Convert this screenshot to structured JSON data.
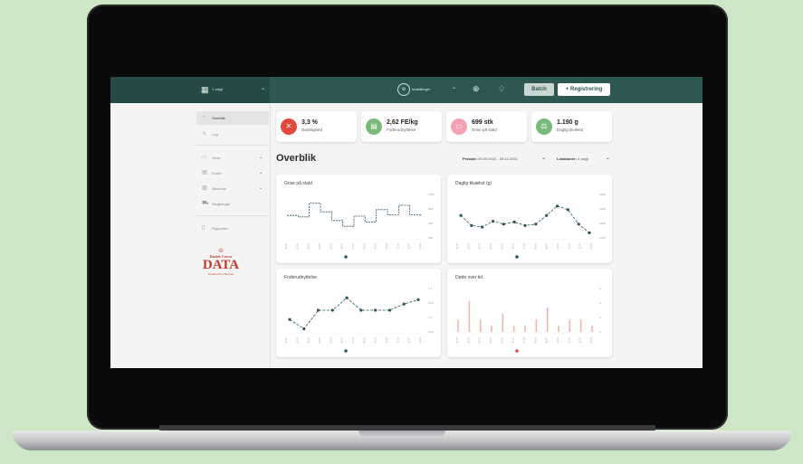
{
  "header": {
    "location_select": "1 valgt",
    "settings_label": "Indstillinger",
    "batch_label": "Batch",
    "register_label": "+ Registrering",
    "icons": [
      "building-icon",
      "settings-icon",
      "globe-icon",
      "bell-icon"
    ]
  },
  "sidebar": {
    "items": [
      {
        "label": "Overblik",
        "icon": "dashboard-icon",
        "active": true
      },
      {
        "label": "Log",
        "icon": "activity-icon"
      },
      {
        "label": "Grise",
        "icon": "pig-icon",
        "expandable": true
      },
      {
        "label": "Foder",
        "icon": "feed-icon",
        "expandable": true
      },
      {
        "label": "Økonomi",
        "icon": "economy-icon",
        "expandable": true
      },
      {
        "label": "Slagtninger",
        "icon": "truck-icon"
      },
      {
        "label": "Rapporter",
        "icon": "report-icon"
      }
    ],
    "logo": {
      "crown": "♔",
      "brand": "Danish Crown",
      "word": "DATA",
      "powered": "Powered by iTerobas"
    }
  },
  "kpis": [
    {
      "value": "3,3 %",
      "label": "Dødelighed",
      "icon": "x-icon",
      "color": "#e0493b"
    },
    {
      "value": "2,62 FE/kg",
      "label": "Foderudnyttelse",
      "icon": "feed-icon",
      "color": "#79b97a"
    },
    {
      "value": "699 stk",
      "label": "Grise på stald",
      "icon": "pig-icon",
      "color": "#f2a2b3"
    },
    {
      "value": "1.190 g",
      "label": "Daglig tilvækst",
      "icon": "scale-icon",
      "color": "#79b97a"
    }
  ],
  "main": {
    "title": "Overblik",
    "period_label": "Periode:",
    "period_value": "09.09.2021 - 09.12.2021",
    "location_label": "Lokationer:",
    "location_value": "1 valgt"
  },
  "colors": {
    "brand": "#2f5752",
    "line": "#2f5752",
    "bar": "#f3b6ad",
    "dot_red": "#e0493b"
  },
  "chart_data": [
    {
      "type": "line",
      "title": "Grise på stald",
      "style": "step-dashed",
      "x": [
        "01.01",
        "02.01",
        "03.01",
        "04.01",
        "05.01",
        "06.01",
        "07.01",
        "08.01",
        "09.01",
        "10.01",
        "11.01",
        "12.01",
        "13.01"
      ],
      "yticks": [
        "400",
        "600",
        "800",
        "1000"
      ],
      "ylim": [
        400,
        1000
      ],
      "values": [
        710,
        690,
        880,
        760,
        640,
        560,
        700,
        620,
        790,
        720,
        850,
        720,
        700
      ],
      "pager_dots": 1
    },
    {
      "type": "line",
      "title": "Daglig tilvækst (g)",
      "x": [
        "01.01",
        "02.01",
        "03.01",
        "04.01",
        "05.01",
        "06.01",
        "07.01",
        "08.01",
        "09.01",
        "10.01",
        "11.01",
        "12.01",
        "13.01"
      ],
      "yticks": [
        "1100",
        "1200",
        "1300",
        "1400"
      ],
      "ylim": [
        1100,
        1400
      ],
      "values": [
        1255,
        1185,
        1175,
        1215,
        1195,
        1210,
        1185,
        1195,
        1255,
        1320,
        1295,
        1195,
        1135
      ],
      "pager_dots": 1
    },
    {
      "type": "line",
      "title": "Foderudnyttelse",
      "x": [
        "01.01",
        "02.01",
        "03.01",
        "04.01",
        "05.01",
        "06.01",
        "07.01",
        "08.01",
        "09.01",
        "10.01",
        "11.01",
        "12.01",
        "13.01"
      ],
      "yticks": [
        "2.00",
        "2.5",
        "2.65",
        "2.7"
      ],
      "ylim": [
        2.0,
        2.7
      ],
      "values": [
        2.2,
        2.05,
        2.35,
        2.35,
        2.55,
        2.35,
        2.35,
        2.35,
        2.45,
        2.52
      ],
      "pager_dots": 1
    },
    {
      "type": "bar",
      "title": "Døde over tid",
      "x": [
        "01.01",
        "02.01",
        "03.01",
        "04.01",
        "05.01",
        "06.01",
        "07.01",
        "08.01",
        "09.01",
        "10.01",
        "11.01",
        "12.01",
        "13.01"
      ],
      "yticks": [
        "0",
        "2",
        "4",
        "6"
      ],
      "ylim": [
        0,
        7
      ],
      "values": [
        2,
        5,
        2,
        1,
        3,
        1,
        1,
        2,
        4,
        1,
        2,
        2,
        1
      ],
      "pager_dots": 1
    }
  ]
}
